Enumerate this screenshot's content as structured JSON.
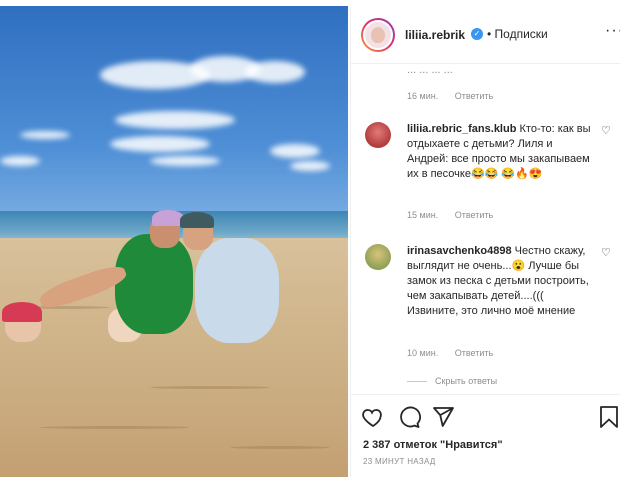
{
  "post": {
    "photo_alt_name": "beach-photo",
    "author": {
      "username": "liliia.rebrik",
      "verified": true,
      "follow_label": "Подписки",
      "separator": "•"
    },
    "comments": [
      {
        "partial_text": "... ... ... ...",
        "time": "16 мин.",
        "reply_label": "Ответить"
      },
      {
        "username": "liliia.rebric_fans.klub",
        "text": "Кто-то: как вы отдыхаете с детьми? Лиля и Андрей: все просто мы закапываем их в песочке😂😂 😂🔥😍",
        "time": "15 мин.",
        "reply_label": "Ответить"
      },
      {
        "username": "irinasavchenko4898",
        "text": "Честно скажу, выглядит не очень...😮 Лучше бы замок из песка с детьми построить, чем закапывать детей....((( Извините, это лично моё мнение",
        "time": "10 мин.",
        "reply_label": "Ответить"
      }
    ],
    "hide_replies_label": "Скрыть ответы",
    "likes_text": "2 387 отметок \"Нравится\"",
    "posted_ago": "23 МИНУТ НАЗАД",
    "icons": [
      "heart-icon",
      "comment-icon",
      "share-icon",
      "bookmark-icon",
      "more-icon",
      "verified-icon"
    ],
    "colors": {
      "verified": "#3897f0",
      "meta_gray": "#8e8e8e",
      "text": "#262626"
    }
  }
}
